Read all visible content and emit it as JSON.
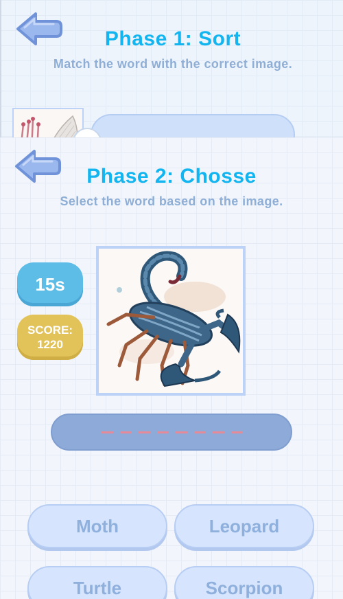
{
  "phase1": {
    "title": "Phase 1: Sort",
    "subtitle": "Match the word with the correct image."
  },
  "phase2": {
    "title": "Phase 2: Chosse",
    "subtitle": "Select the word based on the image.",
    "timer": "15s",
    "score_label": "SCORE:",
    "score_value": "1220",
    "image_icon": "scorpion-illustration",
    "answer_letters": 8,
    "options": [
      "Moth",
      "Leopard",
      "Turtle",
      "Scorpion"
    ]
  },
  "colors": {
    "title": "#12b5ef",
    "subtitle": "#8eaed6",
    "timer": "#5dbde6",
    "score": "#e2c35a",
    "option_bg": "#d6e5fd",
    "answer_bar": "#8daad8",
    "dash": "#e58a96"
  }
}
